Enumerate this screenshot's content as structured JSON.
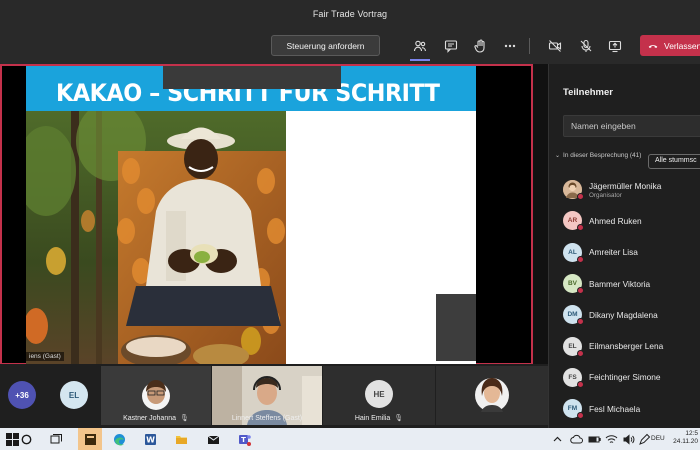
{
  "window": {
    "title": "Fair Trade Vortrag"
  },
  "toolbar": {
    "request_control_label": "Steuerung anfordern",
    "leave_label": "Verlassen",
    "icons": [
      "participants-icon",
      "chat-icon",
      "raise-hand-icon",
      "more-options-icon",
      "camera-off-icon",
      "mic-off-icon",
      "share-tray-icon",
      "phone-hangup-icon"
    ],
    "leave_color": "#c4314b",
    "active_color": "#7b83eb"
  },
  "presentation": {
    "slide_title": "KAKAO – SCHRITT FÜR SCHRITT",
    "header_color": "#1aa3dc",
    "presenter_label": "iens (Gast)",
    "frame_color": "#c4314b"
  },
  "panel": {
    "title": "Teilnehmer",
    "search_placeholder": "Namen eingeben",
    "section_label": "In dieser Besprechung (41)",
    "mute_all_label": "Alle stummsc",
    "participants": [
      {
        "name": "Jägermüller Monika",
        "role": "Organisator",
        "initials": "",
        "color": "#c8a27a"
      },
      {
        "name": "Ahmed Ruken",
        "role": "",
        "initials": "AR",
        "color": "#f4c7c3"
      },
      {
        "name": "Amreiter Lisa",
        "role": "",
        "initials": "AL",
        "color": "#cfe3ef"
      },
      {
        "name": "Bammer Viktoria",
        "role": "",
        "initials": "BV",
        "color": "#d6e8c4"
      },
      {
        "name": "Dikany Magdalena",
        "role": "",
        "initials": "DM",
        "color": "#cfe3ef"
      },
      {
        "name": "Eilmansberger Lena",
        "role": "",
        "initials": "EL",
        "color": "#e2e2e2"
      },
      {
        "name": "Feichtinger Simone",
        "role": "",
        "initials": "FS",
        "color": "#e2e2e2"
      },
      {
        "name": "Fesl Michaela",
        "role": "",
        "initials": "FM",
        "color": "#cfe3ef"
      }
    ]
  },
  "strip": {
    "overflow_count": "+36",
    "tiles": [
      {
        "name": "",
        "initials": "EL"
      },
      {
        "name": "Kastner Johanna",
        "initials": ""
      },
      {
        "name": "Linnert Steffens (Gast)",
        "initials": ""
      },
      {
        "name": "Hain Emilia",
        "initials": "HE"
      },
      {
        "name": "",
        "initials": ""
      }
    ]
  },
  "taskbar": {
    "icons": [
      "windows-start-icon",
      "search-circle-icon",
      "task-view-icon",
      "notes-app-icon",
      "edge-browser-icon",
      "word-icon",
      "file-explorer-icon",
      "mail-icon",
      "teams-icon"
    ],
    "language": "DEU",
    "time": "12:5",
    "date": "24.11.20"
  }
}
